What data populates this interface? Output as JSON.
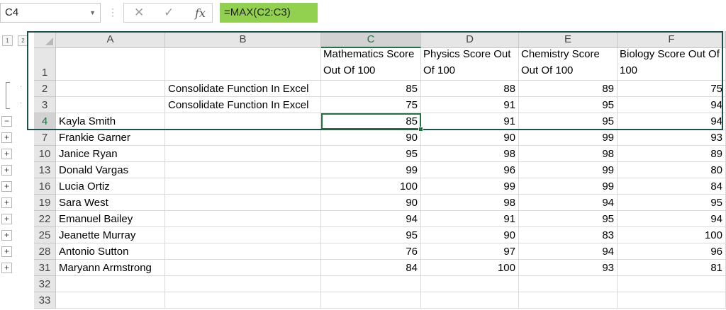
{
  "name_box": "C4",
  "formula": "=MAX(C2:C3)",
  "outline_levels": [
    "1",
    "2"
  ],
  "columns": [
    "A",
    "B",
    "C",
    "D",
    "E",
    "F"
  ],
  "selected_column": "C",
  "rows": [
    {
      "num": "1",
      "a": "",
      "b": "",
      "c": "Mathematics Score Out Of 100",
      "d": "Physics Score Out Of 100",
      "e": "Chemistry Score Out Of 100",
      "f": "Biology Score Out Of 100"
    },
    {
      "num": "2",
      "a": "",
      "b": "Consolidate Function In Excel",
      "c": "85",
      "d": "88",
      "e": "89",
      "f": "75"
    },
    {
      "num": "3",
      "a": "",
      "b": "Consolidate Function In Excel",
      "c": "75",
      "d": "91",
      "e": "95",
      "f": "94"
    },
    {
      "num": "4",
      "a": "Kayla Smith",
      "b": "",
      "c": "85",
      "d": "91",
      "e": "95",
      "f": "94"
    },
    {
      "num": "7",
      "a": "Frankie Garner",
      "b": "",
      "c": "90",
      "d": "90",
      "e": "99",
      "f": "93"
    },
    {
      "num": "10",
      "a": "Janice Ryan",
      "b": "",
      "c": "95",
      "d": "98",
      "e": "98",
      "f": "89"
    },
    {
      "num": "13",
      "a": "Donald Vargas",
      "b": "",
      "c": "99",
      "d": "96",
      "e": "99",
      "f": "80"
    },
    {
      "num": "16",
      "a": "Lucia Ortiz",
      "b": "",
      "c": "100",
      "d": "99",
      "e": "99",
      "f": "84"
    },
    {
      "num": "19",
      "a": "Sara West",
      "b": "",
      "c": "90",
      "d": "98",
      "e": "94",
      "f": "95"
    },
    {
      "num": "22",
      "a": "Emanuel Bailey",
      "b": "",
      "c": "94",
      "d": "91",
      "e": "95",
      "f": "94"
    },
    {
      "num": "25",
      "a": "Jeanette Murray",
      "b": "",
      "c": "95",
      "d": "90",
      "e": "83",
      "f": "100"
    },
    {
      "num": "28",
      "a": "Antonio Sutton",
      "b": "",
      "c": "76",
      "d": "97",
      "e": "94",
      "f": "96"
    },
    {
      "num": "31",
      "a": "Maryann Armstrong",
      "b": "",
      "c": "84",
      "d": "100",
      "e": "93",
      "f": "81"
    },
    {
      "num": "32",
      "a": "",
      "b": "",
      "c": "",
      "d": "",
      "e": "",
      "f": ""
    },
    {
      "num": "33",
      "a": "",
      "b": "",
      "c": "",
      "d": "",
      "e": "",
      "f": ""
    }
  ],
  "outline_buttons": [
    "−",
    "+",
    "+",
    "+",
    "+",
    "+",
    "+",
    "+",
    "+",
    "+"
  ],
  "icons": [
    "dropdown-arrow-icon",
    "cancel-x-icon",
    "enter-check-icon",
    "insert-function-icon",
    "select-all-icon"
  ],
  "colors": {
    "accent": "#217346",
    "formula_bg": "#92d050",
    "range_border": "#1f4e4f"
  }
}
